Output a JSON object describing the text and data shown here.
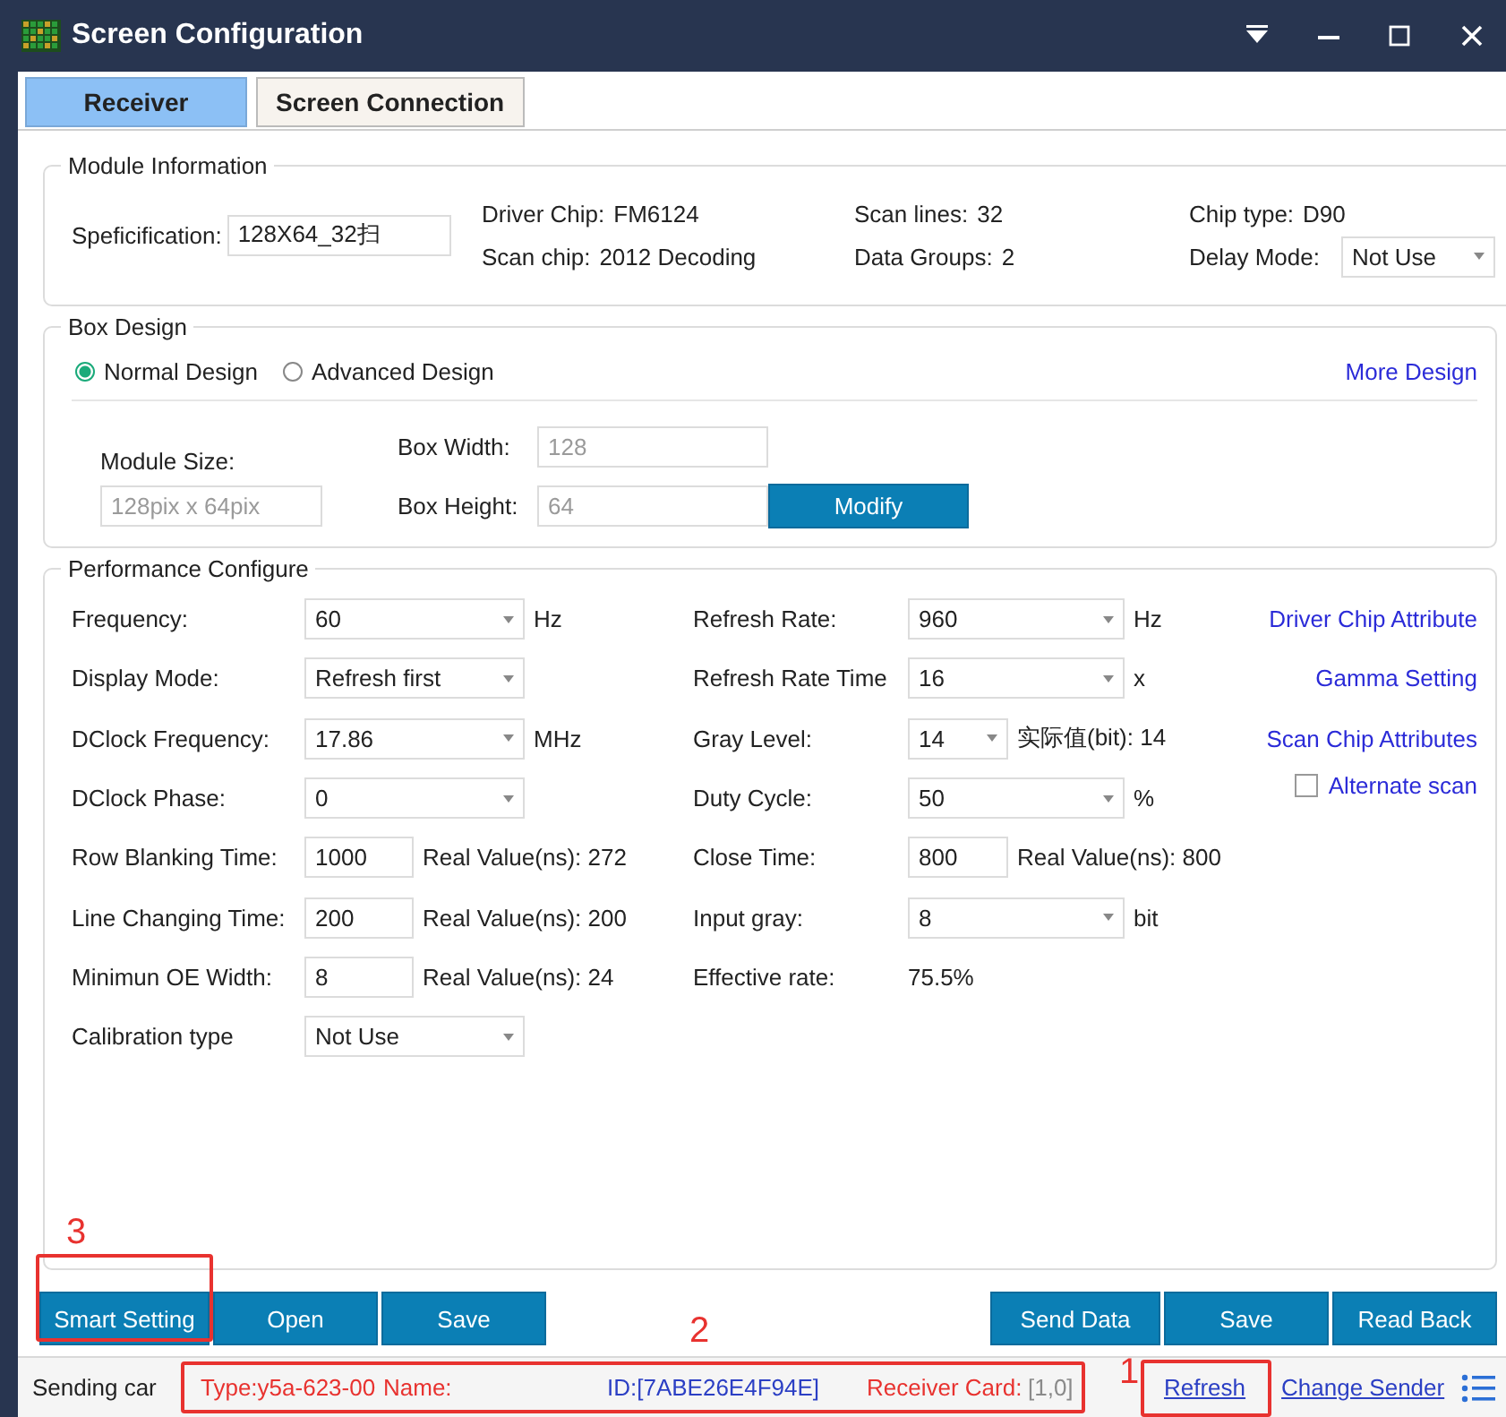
{
  "window": {
    "title": "Screen Configuration"
  },
  "tabs": [
    {
      "label": "Receiver",
      "selected": true
    },
    {
      "label": "Screen Connection",
      "selected": false
    }
  ],
  "module_information": {
    "title": "Module Information",
    "specification": {
      "label": "Speficification:",
      "value": "128X64_32扫"
    },
    "columns": [
      [
        {
          "label": "Driver Chip:",
          "value": "FM6124",
          "kind": "text"
        },
        {
          "label": "Scan chip:",
          "value": "2012 Decoding",
          "kind": "text"
        }
      ],
      [
        {
          "label": "Scan lines:",
          "value": "32",
          "kind": "text"
        },
        {
          "label": "Data Groups:",
          "value": "2",
          "kind": "text"
        }
      ],
      [
        {
          "label": "Chip type:",
          "value": "D90",
          "kind": "text"
        },
        {
          "label": "Delay Mode:",
          "value": "Not Use",
          "kind": "select"
        }
      ]
    ]
  },
  "box_design": {
    "title": "Box Design",
    "options": [
      {
        "label": "Normal Design",
        "selected": true
      },
      {
        "label": "Advanced Design",
        "selected": false
      }
    ],
    "more_link": "More Design",
    "module_size": {
      "label": "Module Size:",
      "value": "128pix x 64pix",
      "disabled": true
    },
    "box_width": {
      "label": "Box Width:",
      "value": "128",
      "disabled": true
    },
    "box_height": {
      "label": "Box Height:",
      "value": "64",
      "disabled": true
    },
    "modify_button": "Modify"
  },
  "performance": {
    "title": "Performance Configure",
    "left": [
      {
        "label": "Frequency:",
        "kind": "select",
        "value": "60",
        "unit": "Hz"
      },
      {
        "label": "Display Mode:",
        "kind": "select",
        "value": "Refresh first"
      },
      {
        "label": "DClock Frequency:",
        "kind": "select",
        "value": "17.86",
        "unit": "MHz"
      },
      {
        "label": "DClock Phase:",
        "kind": "select",
        "value": "0"
      },
      {
        "label": "Row Blanking Time:",
        "kind": "input",
        "value": "1000",
        "unit": "Real Value(ns): 272"
      },
      {
        "label": "Line Changing Time:",
        "kind": "input",
        "value": "200",
        "unit": "Real Value(ns): 200"
      },
      {
        "label": "Minimun OE Width:",
        "kind": "input",
        "value": "8",
        "unit": "Real Value(ns): 24"
      },
      {
        "label": "Calibration type",
        "kind": "select",
        "value": "Not Use"
      }
    ],
    "middle": [
      {
        "label": "Refresh Rate:",
        "kind": "select",
        "value": "960",
        "unit": "Hz"
      },
      {
        "label": "Refresh Rate Time",
        "kind": "select",
        "value": "16",
        "unit": "x"
      },
      {
        "label": "Gray Level:",
        "kind": "short_select",
        "value": "14",
        "unit": "实际值(bit): 14"
      },
      {
        "label": "Duty Cycle:",
        "kind": "select",
        "value": "50",
        "unit": "%"
      },
      {
        "label": "Close Time:",
        "kind": "input",
        "value": "800",
        "unit": "Real Value(ns): 800"
      },
      {
        "label": "Input gray:",
        "kind": "select",
        "value": "8",
        "unit": "bit"
      },
      {
        "label": "Effective rate:",
        "kind": "text",
        "value": "75.5%"
      }
    ],
    "right": [
      {
        "kind": "link",
        "label": "Driver Chip Attribute"
      },
      {
        "kind": "link",
        "label": "Gamma Setting"
      },
      {
        "kind": "link",
        "label": "Scan Chip Attributes"
      },
      {
        "kind": "checkbox",
        "label": "Alternate scan",
        "checked": false
      }
    ]
  },
  "buttons_left": [
    "Smart Setting",
    "Open",
    "Save"
  ],
  "buttons_right": [
    "Send Data",
    "Save",
    "Read Back"
  ],
  "status_bar": {
    "label": "Sending car",
    "items": [
      {
        "text": "Type:y5a-623-00",
        "color": "#e8322f"
      },
      {
        "text": "Name:",
        "color": "#e8322f"
      },
      {
        "text": "ID:[7ABE26E4F94E]",
        "color": "#2b3fc4"
      },
      {
        "text": "Receiver Card:",
        "color": "#e8322f"
      },
      {
        "text": "[1,0]",
        "color": "#8a8a8a"
      }
    ],
    "links": [
      "Refresh",
      "Change Sender"
    ]
  },
  "annotations": [
    {
      "label": "3"
    },
    {
      "label": "2"
    },
    {
      "label": "1"
    }
  ]
}
